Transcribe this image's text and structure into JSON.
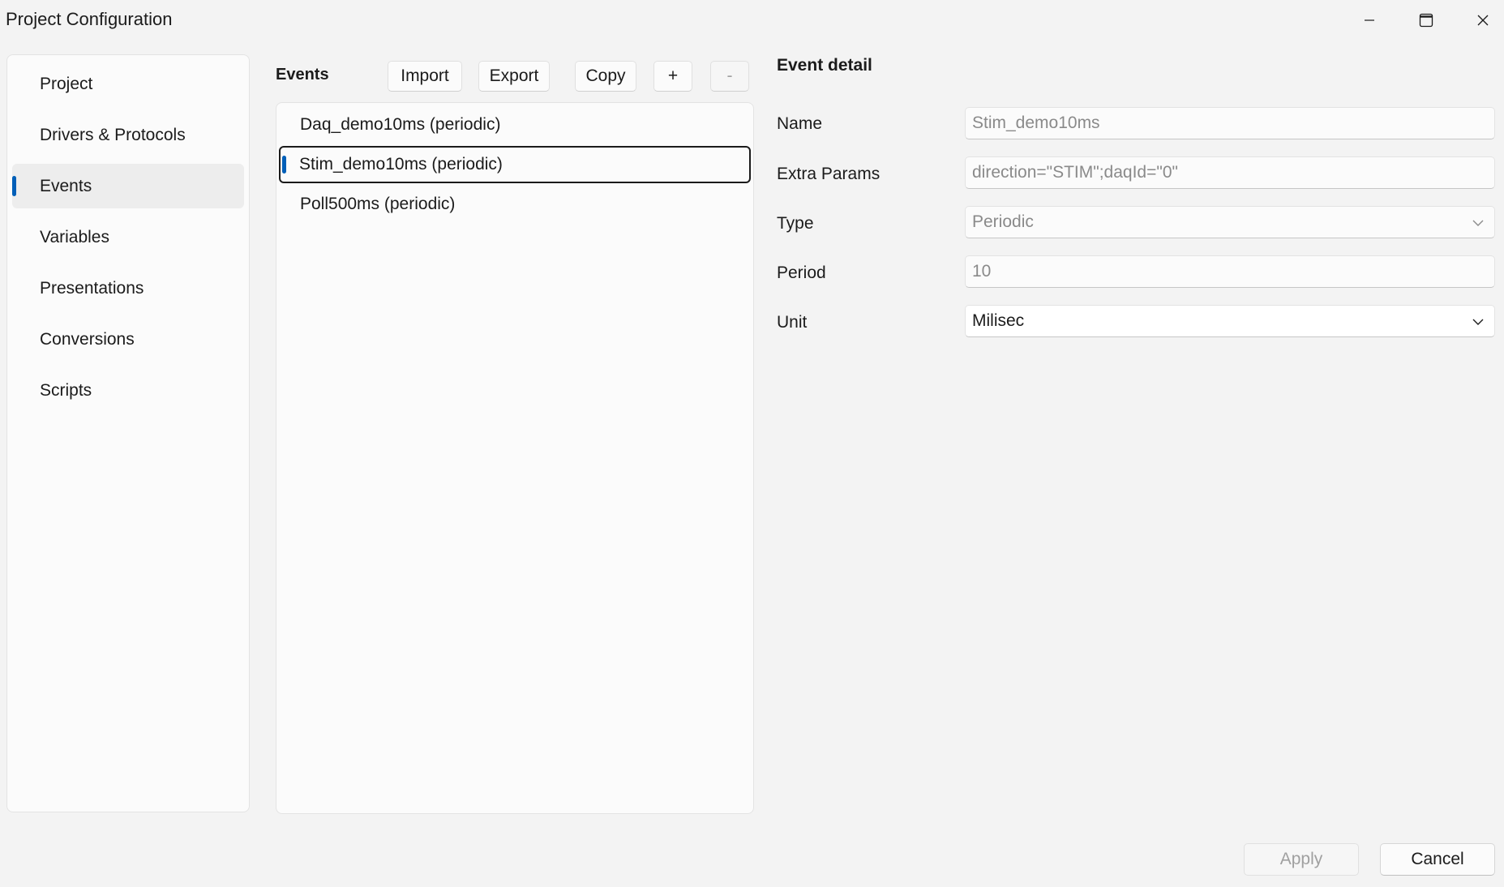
{
  "window": {
    "title": "Project Configuration"
  },
  "sidebar": {
    "items": [
      {
        "label": "Project"
      },
      {
        "label": "Drivers & Protocols"
      },
      {
        "label": "Events",
        "selected": true
      },
      {
        "label": "Variables"
      },
      {
        "label": "Presentations"
      },
      {
        "label": "Conversions"
      },
      {
        "label": "Scripts"
      }
    ]
  },
  "events": {
    "heading": "Events",
    "toolbar": {
      "import_label": "Import",
      "export_label": "Export",
      "copy_label": "Copy",
      "add_label": "+",
      "remove_label": "-"
    },
    "list": [
      {
        "label": "Daq_demo10ms (periodic)"
      },
      {
        "label": "Stim_demo10ms (periodic)",
        "selected": true
      },
      {
        "label": "Poll500ms (periodic)"
      }
    ]
  },
  "detail": {
    "title": "Event detail",
    "name": {
      "label": "Name",
      "value": "Stim_demo10ms"
    },
    "extra_params": {
      "label": "Extra Params",
      "value": "direction=\"STIM\";daqId=\"0\""
    },
    "type": {
      "label": "Type",
      "value": "Periodic"
    },
    "period": {
      "label": "Period",
      "value": "10"
    },
    "unit": {
      "label": "Unit",
      "value": "Milisec"
    }
  },
  "footer": {
    "apply_label": "Apply",
    "cancel_label": "Cancel"
  },
  "colors": {
    "accent": "#005fb8",
    "background": "#f3f3f3",
    "panel": "#fbfbfb"
  }
}
